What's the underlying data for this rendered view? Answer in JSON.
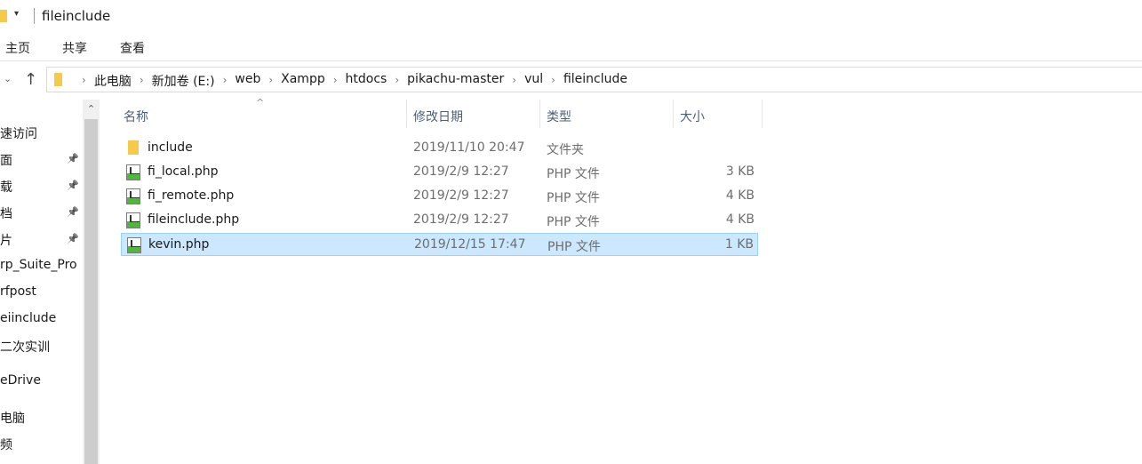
{
  "window": {
    "title": "fileinclude",
    "quick_access": "▾"
  },
  "ribbon": {
    "tabs": [
      "主页",
      "共享",
      "查看"
    ]
  },
  "address": {
    "crumbs": [
      "此电脑",
      "新加卷 (E:)",
      "web",
      "Xampp",
      "htdocs",
      "pikachu-master",
      "vul",
      "fileinclude"
    ]
  },
  "nav": {
    "items": [
      {
        "label": "速访问",
        "pinned": false
      },
      {
        "label": "面",
        "pinned": true
      },
      {
        "label": "载",
        "pinned": true
      },
      {
        "label": "档",
        "pinned": true
      },
      {
        "label": "片",
        "pinned": true
      },
      {
        "label": "rp_Suite_Pro",
        "pinned": false
      },
      {
        "label": "rfpost",
        "pinned": false
      },
      {
        "label": "eiinclude",
        "pinned": false
      },
      {
        "label": "二次实训",
        "pinned": false
      },
      {
        "label": "eDrive",
        "pinned": false
      },
      {
        "label": "电脑",
        "pinned": false
      },
      {
        "label": "频",
        "pinned": false
      }
    ]
  },
  "columns": {
    "name": "名称",
    "date": "修改日期",
    "type": "类型",
    "size": "大小"
  },
  "files": [
    {
      "name": "include",
      "date": "2019/11/10 20:47",
      "type": "文件夹",
      "size": "",
      "icon": "folder-icon",
      "selected": false
    },
    {
      "name": "fi_local.php",
      "date": "2019/2/9 12:27",
      "type": "PHP 文件",
      "size": "3 KB",
      "icon": "php-file-icon",
      "selected": false
    },
    {
      "name": "fi_remote.php",
      "date": "2019/2/9 12:27",
      "type": "PHP 文件",
      "size": "4 KB",
      "icon": "php-file-icon",
      "selected": false
    },
    {
      "name": "fileinclude.php",
      "date": "2019/2/9 12:27",
      "type": "PHP 文件",
      "size": "4 KB",
      "icon": "php-file-icon",
      "selected": false
    },
    {
      "name": "kevin.php",
      "date": "2019/12/15 17:47",
      "type": "PHP 文件",
      "size": "1 KB",
      "icon": "php-file-icon",
      "selected": true
    }
  ],
  "colors": {
    "selection": "#cce8ff",
    "folder": "#f6c94a",
    "header_text": "#4c607a"
  }
}
